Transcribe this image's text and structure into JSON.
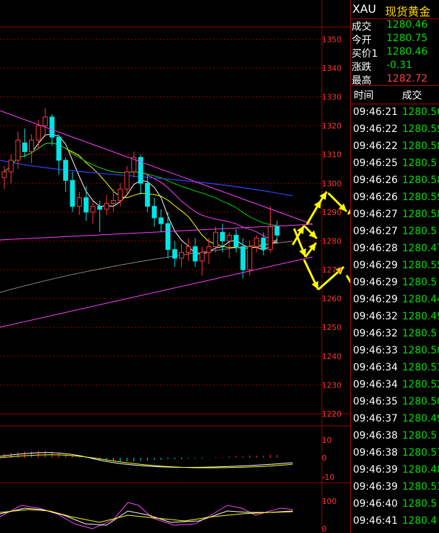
{
  "colors": {
    "up": "#ff3a3a",
    "down": "#00e5e5",
    "ma5": "#ffffff",
    "ma10": "#ffff00",
    "ma20": "#ff40ff",
    "ma30": "#00d000",
    "ma60": "#3344ff",
    "ma120": "#888888",
    "annotation": "#ffff00",
    "grid": "#990000"
  },
  "header": {
    "symbol": "XAU",
    "name": "现货黄金"
  },
  "quote": [
    {
      "label": "成交",
      "value": "1280.46",
      "color": "#00e000"
    },
    {
      "label": "今开",
      "value": "1280.75",
      "color": "#00e000"
    },
    {
      "label": "买价1",
      "value": "1280.46",
      "color": "#00e000"
    },
    {
      "label": "涨跌",
      "value": "-0.31",
      "color": "#00e000"
    },
    {
      "label": "最高",
      "value": "1282.72",
      "color": "#ff4040"
    }
  ],
  "ticks": {
    "columns": [
      "时间",
      "成交"
    ],
    "rows": [
      {
        "time": "09:46:21",
        "price": "1280.56"
      },
      {
        "time": "09:46:22",
        "price": "1280.59"
      },
      {
        "time": "09:46:22",
        "price": "1280.58"
      },
      {
        "time": "09:46:25",
        "price": "1280.5"
      },
      {
        "time": "09:46:26",
        "price": "1280.58"
      },
      {
        "time": "09:46:26",
        "price": "1280.59"
      },
      {
        "time": "09:46:27",
        "price": "1280.58"
      },
      {
        "time": "09:46:27",
        "price": "1280.5"
      },
      {
        "time": "09:46:28",
        "price": "1280.47"
      },
      {
        "time": "09:46:29",
        "price": "1280.55"
      },
      {
        "time": "09:46:29",
        "price": "1280.5"
      },
      {
        "time": "09:46:29",
        "price": "1280.44"
      },
      {
        "time": "09:46:32",
        "price": "1280.49"
      },
      {
        "time": "09:46:32",
        "price": "1280.5"
      },
      {
        "time": "09:46:33",
        "price": "1280.50"
      },
      {
        "time": "09:46:34",
        "price": "1280.51"
      },
      {
        "time": "09:46:34",
        "price": "1280.52"
      },
      {
        "time": "09:46:35",
        "price": "1280.50"
      },
      {
        "time": "09:46:37",
        "price": "1280.49"
      },
      {
        "time": "09:46:38",
        "price": "1280.5"
      },
      {
        "time": "09:46:38",
        "price": "1280.57"
      },
      {
        "time": "09:46:39",
        "price": "1280.48"
      },
      {
        "time": "09:46:39",
        "price": "1280.51"
      },
      {
        "time": "09:46:40",
        "price": "1280.5"
      },
      {
        "time": "09:46:41",
        "price": "1280.4"
      }
    ]
  },
  "chart_data": [
    {
      "type": "candlestick",
      "ylim": [
        1220,
        1355
      ],
      "yticks": [
        "1350",
        "1340",
        "1330",
        "1320",
        "1310",
        "1300",
        "1290",
        "1280",
        "1270",
        "1260",
        "1250",
        "1240",
        "1230",
        "1220"
      ],
      "ohlc": [
        [
          1302,
          1306,
          1298,
          1304
        ],
        [
          1304,
          1310,
          1300,
          1308
        ],
        [
          1308,
          1318,
          1305,
          1315
        ],
        [
          1314,
          1319,
          1309,
          1311
        ],
        [
          1311,
          1317,
          1307,
          1315
        ],
        [
          1315,
          1322,
          1312,
          1320
        ],
        [
          1320,
          1326,
          1316,
          1323
        ],
        [
          1323,
          1324,
          1313,
          1316
        ],
        [
          1316,
          1317,
          1303,
          1308
        ],
        [
          1308,
          1309,
          1297,
          1301
        ],
        [
          1301,
          1304,
          1290,
          1292
        ],
        [
          1292,
          1297,
          1289,
          1295
        ],
        [
          1295,
          1299,
          1287,
          1290
        ],
        [
          1290,
          1294,
          1286,
          1292
        ],
        [
          1292,
          1294,
          1283,
          1291
        ],
        [
          1291,
          1296,
          1289,
          1293
        ],
        [
          1293,
          1298,
          1290,
          1294
        ],
        [
          1294,
          1300,
          1292,
          1298
        ],
        [
          1298,
          1306,
          1296,
          1304
        ],
        [
          1304,
          1311,
          1302,
          1309
        ],
        [
          1309,
          1310,
          1296,
          1300
        ],
        [
          1300,
          1303,
          1290,
          1292
        ],
        [
          1292,
          1295,
          1285,
          1288
        ],
        [
          1288,
          1291,
          1283,
          1286
        ],
        [
          1286,
          1290,
          1274,
          1277
        ],
        [
          1277,
          1280,
          1271,
          1274
        ],
        [
          1274,
          1279,
          1271,
          1276
        ],
        [
          1276,
          1281,
          1273,
          1278
        ],
        [
          1278,
          1281,
          1271,
          1273
        ],
        [
          1273,
          1278,
          1268,
          1276
        ],
        [
          1276,
          1281,
          1272,
          1278
        ],
        [
          1278,
          1285,
          1276,
          1283
        ],
        [
          1283,
          1286,
          1276,
          1280
        ],
        [
          1280,
          1283,
          1274,
          1282
        ],
        [
          1282,
          1284,
          1276,
          1278
        ],
        [
          1278,
          1281,
          1267,
          1270
        ],
        [
          1270,
          1280,
          1268,
          1278
        ],
        [
          1278,
          1282,
          1276,
          1281
        ],
        [
          1281,
          1283,
          1275,
          1277
        ],
        [
          1277,
          1292,
          1276,
          1285
        ],
        [
          1285,
          1287,
          1279,
          1282
        ]
      ]
    },
    {
      "type": "line",
      "name": "MACD",
      "ylim": [
        -10,
        10
      ],
      "yticks": [
        "10",
        "0",
        "-10"
      ]
    },
    {
      "type": "line",
      "name": "KDJ",
      "yticks": [
        "100",
        "0"
      ]
    }
  ]
}
